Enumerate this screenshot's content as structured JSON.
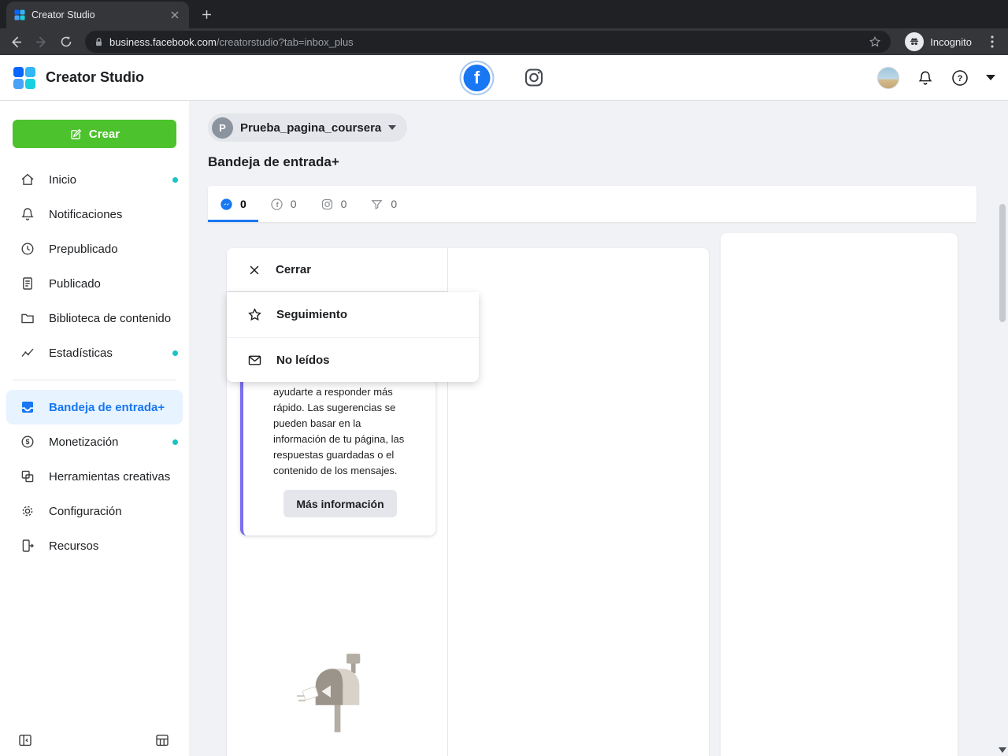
{
  "browser": {
    "tab_title": "Creator Studio",
    "url_domain": "business.facebook.com",
    "url_path": "/creatorstudio?tab=inbox_plus",
    "incognito_label": "Incognito"
  },
  "header": {
    "app_title": "Creator Studio"
  },
  "sidebar": {
    "create_button": "Crear",
    "items": [
      {
        "label": "Inicio",
        "icon": "home-icon",
        "dot": true,
        "active": false
      },
      {
        "label": "Notificaciones",
        "icon": "bell-icon",
        "dot": false,
        "active": false
      },
      {
        "label": "Prepublicado",
        "icon": "clock-icon",
        "dot": false,
        "active": false
      },
      {
        "label": "Publicado",
        "icon": "document-icon",
        "dot": false,
        "active": false
      },
      {
        "label": "Biblioteca de contenido",
        "icon": "folder-icon",
        "dot": false,
        "active": false
      },
      {
        "label": "Estadísticas",
        "icon": "chart-icon",
        "dot": true,
        "active": false
      },
      {
        "label": "Bandeja de entrada+",
        "icon": "inbox-icon",
        "dot": false,
        "active": true
      },
      {
        "label": "Monetización",
        "icon": "dollar-icon",
        "dot": true,
        "active": false
      },
      {
        "label": "Herramientas creativas",
        "icon": "layers-icon",
        "dot": false,
        "active": false
      },
      {
        "label": "Configuración",
        "icon": "gear-icon",
        "dot": false,
        "active": false
      },
      {
        "label": "Recursos",
        "icon": "resources-icon",
        "dot": false,
        "active": false
      }
    ]
  },
  "main": {
    "page_selector": {
      "initial": "P",
      "name": "Prueba_pagina_coursera"
    },
    "title": "Bandeja de entrada+",
    "tabs": [
      {
        "name": "messenger",
        "count": "0",
        "active": true
      },
      {
        "name": "facebook",
        "count": "0",
        "active": false
      },
      {
        "name": "instagram",
        "count": "0",
        "active": false
      },
      {
        "name": "filter",
        "count": "0",
        "active": false
      }
    ],
    "filter_menu": {
      "close_label": "Cerrar",
      "items": [
        {
          "icon": "star-icon",
          "label": "Seguimiento"
        },
        {
          "icon": "envelope-icon",
          "label": "No leídos"
        }
      ]
    },
    "tip_card": {
      "text": "ayudarte a responder más rápido. Las sugerencias se pueden basar en la información de tu página, las respuestas guardadas o el contenido de los mensajes.",
      "button_label": "Más información"
    }
  },
  "colors": {
    "accent_blue": "#1877f2",
    "create_green": "#4cc22d",
    "notification_teal": "#1bc3c3",
    "tip_purple": "#7a6ff0"
  }
}
